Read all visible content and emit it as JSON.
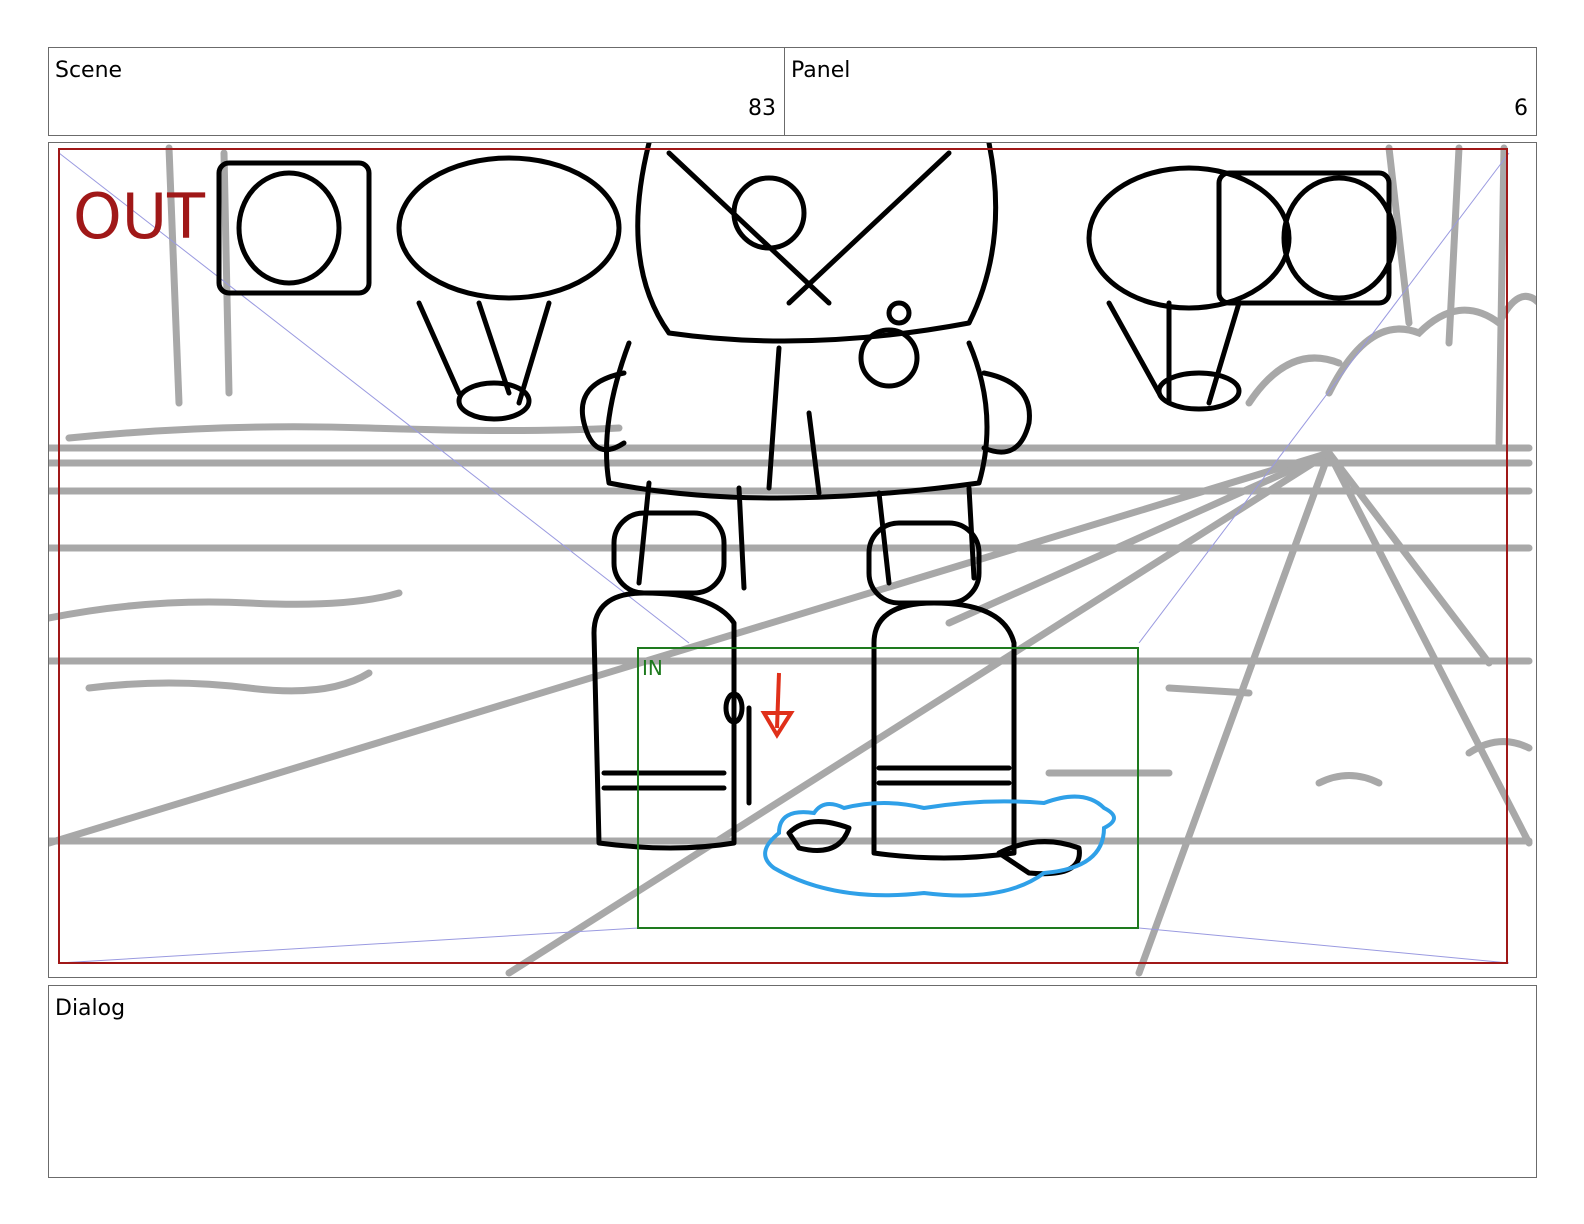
{
  "scene": {
    "label": "Scene",
    "value": "83"
  },
  "panel": {
    "label": "Panel",
    "value": "6"
  },
  "frame": {
    "out_marker": "OUT",
    "in_marker": "IN",
    "colors": {
      "out_frame": "#a01818",
      "in_frame": "#1e7a1e",
      "arrow": "#e0301a",
      "puddle": "#2fa0e8",
      "ink": "#000000",
      "background_lines": "#a8a8a8",
      "perspective_guides": "#9a9ae0"
    }
  },
  "dialog": {
    "label": "Dialog",
    "text": ""
  }
}
